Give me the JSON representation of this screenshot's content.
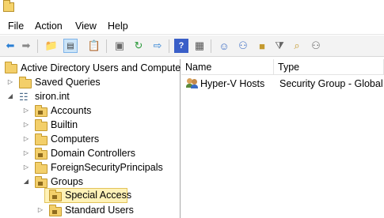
{
  "menu": {
    "items": [
      "File",
      "Action",
      "View",
      "Help"
    ]
  },
  "tree": {
    "root": "Active Directory Users and Computers",
    "saved_queries": "Saved Queries",
    "domain": "siron.int",
    "children": [
      "Accounts",
      "Builtin",
      "Computers",
      "Domain Controllers",
      "ForeignSecurityPrincipals",
      "Groups"
    ],
    "groups_children": [
      "Special Access",
      "Standard Users"
    ]
  },
  "list": {
    "columns": [
      "Name",
      "Type"
    ],
    "rows": [
      {
        "name": "Hyper-V Hosts",
        "type": "Security Group - Global"
      }
    ]
  },
  "colors": {
    "selection": "#fff2b8",
    "folder": "#f3cf6a",
    "toolbar": "#f3f3f3"
  }
}
